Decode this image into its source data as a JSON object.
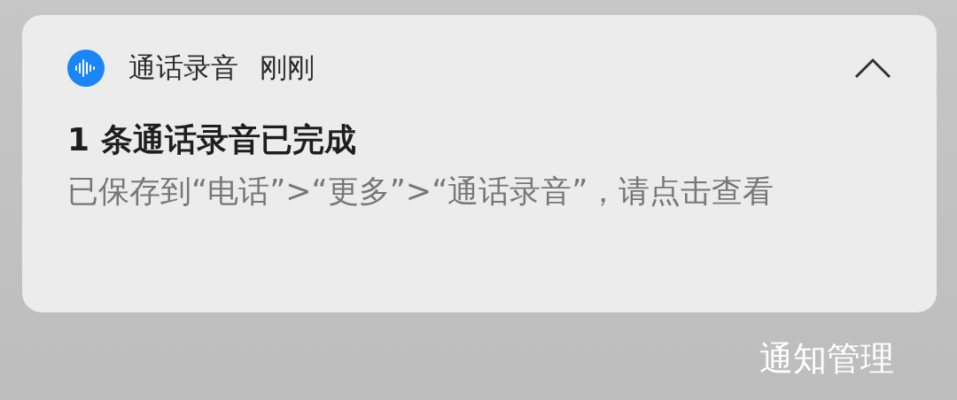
{
  "notification": {
    "app_name": "通话录音",
    "time": "刚刚",
    "expanded": true,
    "title": "1 条通话录音已完成",
    "body": "已保存到“电话”>“更多”>“通话录音”，请点击查看"
  },
  "manage_button": "通知管理"
}
